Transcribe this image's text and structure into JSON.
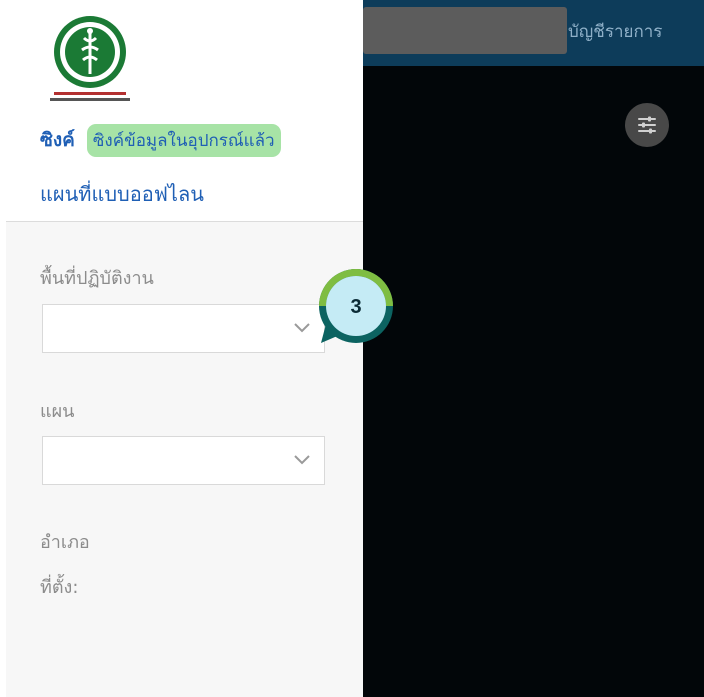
{
  "topbar": {
    "account_label": "บัญชีรายการ"
  },
  "drawer": {
    "logo_alt": "กรมควบคุมโรค กระทรวงสาธารณสุข",
    "sync_label": "ซิงค์",
    "sync_status": "ซิงค์ข้อมูลในอุปกรณ์แล้ว",
    "offline_map_label": "แผนที่แบบออฟไลน",
    "area_label": "พื้นที่ปฏิบัติงาน",
    "area_value": "",
    "plan_label": "แผน",
    "plan_value": "",
    "district_label": "อำเภอ",
    "location_label": "ที่ตั้ง:"
  },
  "tutorial": {
    "step_number": "3"
  },
  "colors": {
    "topbar": "#0d3c5a",
    "link_blue": "#1f5fb5",
    "badge_green": "#a7e3a6",
    "step_ring_green": "#7fbd42",
    "step_ring_teal": "#0c6361",
    "step_fill": "#c5ebf5"
  },
  "icons": [
    "ministry-logo-icon",
    "filter-sliders-icon",
    "chevron-down-icon"
  ]
}
